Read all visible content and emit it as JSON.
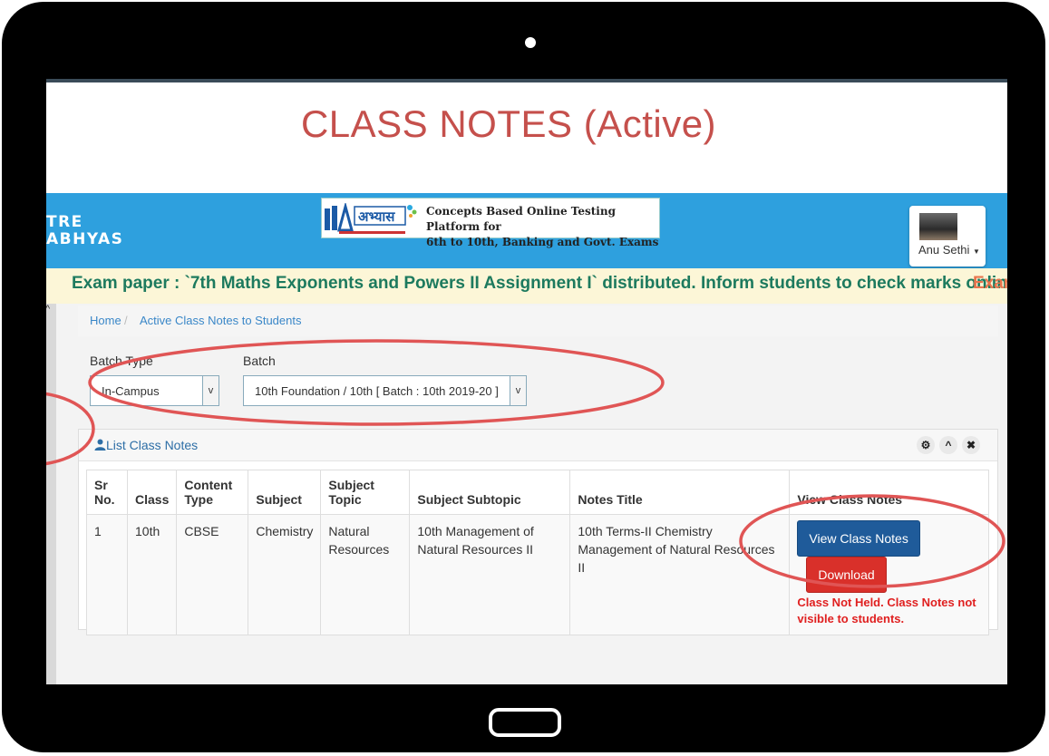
{
  "slide_title": "CLASS NOTES (Active)",
  "app": {
    "brand_lines": [
      "TRE",
      "ABHYAS"
    ],
    "banner_text": [
      "Concepts Based Online Testing Platform for",
      "6th to 10th, Banking and Govt. Exams"
    ],
    "user_name": "Anu Sethi"
  },
  "ticker": {
    "message": "Exam paper : `7th Maths Exponents and Powers II Assignment I` distributed. Inform students to check marks online.",
    "next_fragment": "Exam"
  },
  "breadcrumb": {
    "home": "Home",
    "current": "Active Class Notes to Students"
  },
  "filters": {
    "batch_type_label": "Batch Type",
    "batch_type_value": "In-Campus",
    "batch_label": "Batch",
    "batch_value": "10th Foundation / 10th [ Batch : 10th 2019-20 ]"
  },
  "panel": {
    "title": "List Class Notes",
    "tools": [
      "gear-icon",
      "chevron-up-icon",
      "close-icon"
    ]
  },
  "table": {
    "headers": [
      "Sr No.",
      "Class",
      "Content Type",
      "Subject",
      "Subject Topic",
      "Subject Subtopic",
      "Notes Title",
      "View Class Notes"
    ],
    "rows": [
      {
        "sr": "1",
        "class": "10th",
        "content_type": "CBSE",
        "subject": "Chemistry",
        "topic": "Natural Resources",
        "subtopic": "10th Management of Natural Resources II",
        "notes_title": "10th Terms-II Chemistry Management of Natural Resources II",
        "view_label": "View Class Notes",
        "download_label": "Download",
        "warning": "Class Not Held. Class Notes not visible to students."
      }
    ]
  },
  "colors": {
    "title_red": "#c5504c",
    "app_blue": "#2ea0de",
    "ticker_green": "#1d7a5e",
    "ticker_bg": "#fcf6d7",
    "annotation_red": "#e05555"
  }
}
